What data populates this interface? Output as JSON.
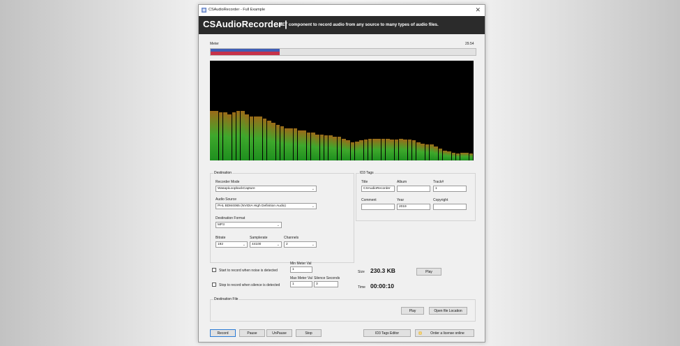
{
  "window": {
    "title": "CSAudioRecorder - Full Example",
    "close_glyph": "✕"
  },
  "banner": {
    "name": "CSAudioRecorder |",
    "tagline": ".NET component to record audio from any source to many types of audio files."
  },
  "meter": {
    "label": "Meter",
    "value": "29.54",
    "level_blue": 0.26,
    "level_red": 0.26
  },
  "visualizer": {
    "colors": {
      "bottom": "#1e8f1e",
      "top": "#9b6a18"
    },
    "bars": [
      0.5,
      0.5,
      0.48,
      0.48,
      0.46,
      0.48,
      0.5,
      0.5,
      0.46,
      0.44,
      0.44,
      0.44,
      0.42,
      0.4,
      0.38,
      0.36,
      0.34,
      0.32,
      0.32,
      0.32,
      0.3,
      0.3,
      0.28,
      0.28,
      0.26,
      0.26,
      0.25,
      0.25,
      0.24,
      0.24,
      0.22,
      0.2,
      0.18,
      0.19,
      0.2,
      0.21,
      0.22,
      0.22,
      0.22,
      0.22,
      0.22,
      0.21,
      0.21,
      0.22,
      0.21,
      0.21,
      0.2,
      0.18,
      0.17,
      0.16,
      0.16,
      0.14,
      0.12,
      0.1,
      0.09,
      0.08,
      0.07,
      0.08,
      0.08,
      0.07
    ]
  },
  "destination": {
    "title": "Destination",
    "recorder_mode": {
      "label": "Recorder Mode",
      "value": "WasapiLoopbackCapture"
    },
    "audio_source": {
      "label": "Audio Source",
      "value": "PHL BDM4065 (NVIDIA High Definition Audio)"
    },
    "format": {
      "label": "Destination Format",
      "value": "MP3"
    },
    "bitrate": {
      "label": "Bitrate",
      "value": "192"
    },
    "samplerate": {
      "label": "Samplerate",
      "value": "44100"
    },
    "channels": {
      "label": "Channels",
      "value": "2"
    }
  },
  "id3": {
    "title": "ID3 Tags",
    "title_field": {
      "label": "Title",
      "value": "CSAudioRecorder"
    },
    "album": {
      "label": "Album",
      "value": ""
    },
    "track": {
      "label": "Track#",
      "value": "1"
    },
    "comment": {
      "label": "Comment",
      "value": ""
    },
    "year": {
      "label": "Year",
      "value": "2019"
    },
    "copyright": {
      "label": "Copyright",
      "value": ""
    }
  },
  "triggers": {
    "start_label": "Start to record when noise is detected",
    "stop_label": "Stop to record when silence is detected",
    "min_meter_label": "Min Meter Val",
    "min_meter_value": "1",
    "max_meter_label": "Max Meter Val",
    "max_meter_value": "1",
    "silence_label": "Silence Seconds",
    "silence_value": "3"
  },
  "stats": {
    "size_label": "Size",
    "size_value": "230.3 KB",
    "time_label": "Time",
    "time_value": "00:00:10",
    "play_label": "Play"
  },
  "dest_file": {
    "title": "Destination File",
    "play_label": "Play",
    "open_label": "Open file Location"
  },
  "footer": {
    "record": "Record",
    "pause": "Pause",
    "unpause": "UnPause",
    "stop": "Stop",
    "id3_editor": "ID3 Tags Editor",
    "order": "Order a license online"
  }
}
